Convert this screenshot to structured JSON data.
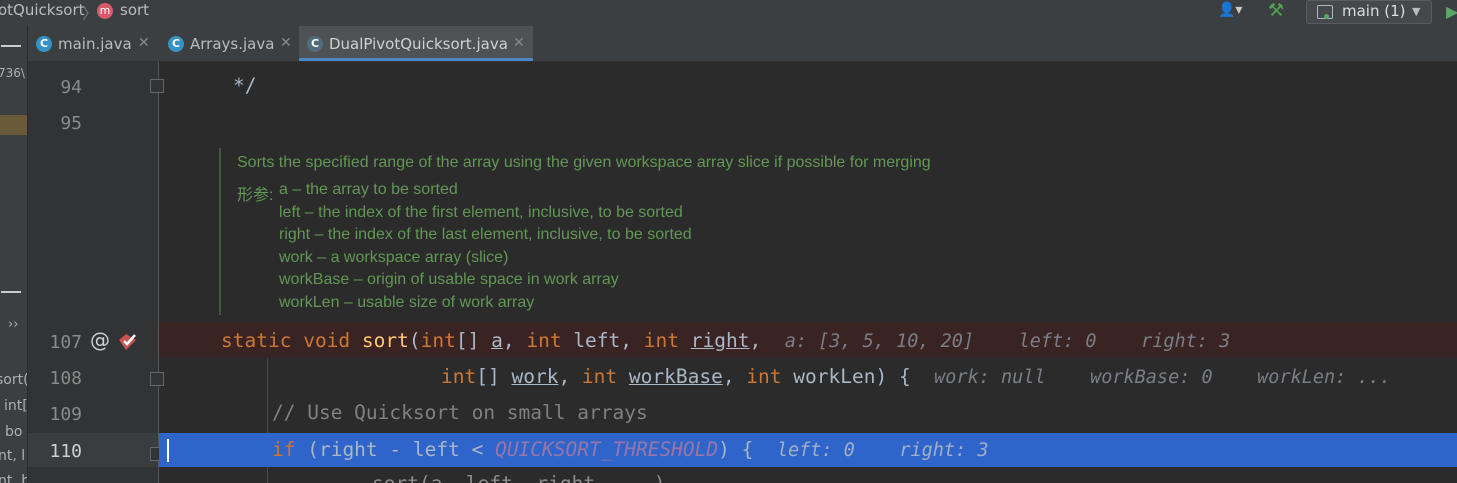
{
  "breadcrumb": {
    "class_crumb": "otQuicksort",
    "method_icon": "m",
    "method_crumb": "sort"
  },
  "toolbar": {
    "run_config": "main (1)"
  },
  "left_panel": {
    "snippets": [
      "736\\",
      "sort(",
      "int[",
      "bo",
      "nt, l",
      "nt, b",
      "››"
    ]
  },
  "tabs": [
    {
      "label": "main.java",
      "icon": "C",
      "active": false
    },
    {
      "label": "Arrays.java",
      "icon": "C",
      "active": false
    },
    {
      "label": "DualPivotQuicksort.java",
      "icon": "C",
      "active": true
    }
  ],
  "gutter": {
    "lines": [
      "94",
      "95",
      "107",
      "108",
      "109",
      "110"
    ]
  },
  "code": {
    "line94": "*/",
    "doc": {
      "summary": "Sorts the specified range of the array using the given workspace array slice if possible for merging",
      "params_label": "形参:",
      "params": [
        "a – the array to be sorted",
        "left – the index of the first element, inclusive, to be sorted",
        "right – the index of the last element, inclusive, to be sorted",
        "work – a workspace array (slice)",
        "workBase – origin of usable space in work array",
        "workLen – usable size of work array"
      ]
    },
    "l107": {
      "static": "static",
      "void": "void",
      "name": "sort",
      "open": "(",
      "int1": "int",
      "arr1": "[] ",
      "a": "a",
      "c1": ", ",
      "int2": "int",
      "left": " left",
      "c2": ", ",
      "int3": "int",
      "right": "right",
      "c3": ",",
      "hint": "a: [3, 5, 10, 20]    left: 0    right: 3"
    },
    "l108": {
      "int1": "int",
      "arr1": "[] ",
      "work": "work",
      "c1": ", ",
      "int2": "int",
      "workBase": "workBase",
      "c2": ", ",
      "int3": "int",
      "workLen": " workLen) {",
      "hint": "work: null    workBase: 0    workLen: ..."
    },
    "l109": "// Use Quicksort on small arrays",
    "l110": {
      "if": "if",
      "expr": " (right - left < ",
      "const": "QUICKSORT_THRESHOLD",
      "close": ") {",
      "hint": "left: 0    right: 3"
    },
    "l111": "sort(a, left, right, ...)"
  }
}
